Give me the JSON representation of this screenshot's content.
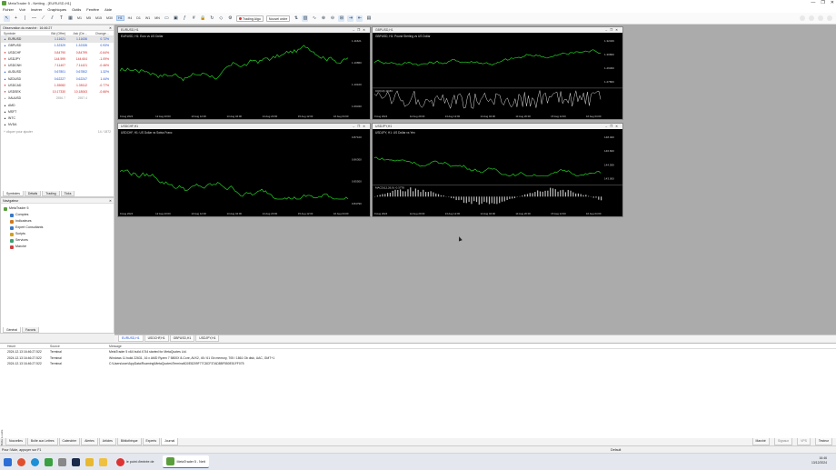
{
  "window": {
    "title": "MetaTrader 5 - Netting - [EURUSD,H1]",
    "min": "—",
    "max": "❐",
    "close": "✕"
  },
  "menu": [
    "Fichier",
    "Voir",
    "Insérer",
    "Graphiques",
    "Outils",
    "Fenêtre",
    "Aide"
  ],
  "toolbar": {
    "timeframes": [
      "M1",
      "M5",
      "M15",
      "M30",
      "H1",
      "H4",
      "D1",
      "W1",
      "MN"
    ],
    "active_timeframe": "H1",
    "algo_label": "Trading Algo",
    "order_label": "Nouvel ordre"
  },
  "market_watch": {
    "title": "Observation du marché : 16:46:27",
    "headers": [
      "Symbole",
      "Bid (Offre)",
      "Ask (De…",
      "Change…"
    ],
    "rows": [
      {
        "symbol": "EURUSD",
        "bid": "1.11621",
        "ask": "1.11636",
        "change": "0.72%",
        "color": "blue"
      },
      {
        "symbol": "GBPUSD",
        "bid": "1.32329",
        "ask": "1.32335",
        "change": "0.93%",
        "color": "blue"
      },
      {
        "symbol": "USDCHF",
        "bid": "0.84790",
        "ask": "0.84799",
        "change": "-0.64%",
        "color": "red"
      },
      {
        "symbol": "USDJPY",
        "bid": "144.599",
        "ask": "144.604",
        "change": "-1.09%",
        "color": "red"
      },
      {
        "symbol": "USDCNH",
        "bid": "7.11407",
        "ask": "7.11421",
        "change": "-0.46%",
        "color": "red"
      },
      {
        "symbol": "AUDUSD",
        "bid": "0.67801",
        "ask": "0.67802",
        "change": "1.32%",
        "color": "blue"
      },
      {
        "symbol": "NZDUSD",
        "bid": "0.62227",
        "ask": "0.62247",
        "change": "1.44%",
        "color": "blue"
      },
      {
        "symbol": "USDCAD",
        "bid": "1.35082",
        "ask": "1.35112",
        "change": "-0.77%",
        "color": "red"
      },
      {
        "symbol": "USDSEK",
        "bid": "10.17330",
        "ask": "10.18063",
        "change": "-0.66%",
        "color": "red"
      },
      {
        "symbol": "XAUUSD",
        "bid": "2556.7",
        "ask": "2557.4",
        "change": "",
        "color": "grey"
      },
      {
        "symbol": "AMD",
        "bid": "",
        "ask": "",
        "change": "",
        "color": "plain"
      },
      {
        "symbol": "MSFT",
        "bid": "",
        "ask": "",
        "change": "",
        "color": "plain"
      },
      {
        "symbol": "INTC",
        "bid": "",
        "ask": "",
        "change": "",
        "color": "plain"
      },
      {
        "symbol": "NVDA",
        "bid": "",
        "ask": "",
        "change": "",
        "color": "plain"
      }
    ],
    "add_symbol": "+ cliquer pour ajouter",
    "count": "14 / 1872",
    "tabs": [
      "Symboles",
      "Détails",
      "Trading",
      "Ticks"
    ]
  },
  "navigator": {
    "title": "Navigateur",
    "items": [
      {
        "label": "MetaTrader 5",
        "indent": 0,
        "color": "#5a9e3c"
      },
      {
        "label": "Comptes",
        "indent": 1,
        "color": "#3a78c8"
      },
      {
        "label": "Indicateurs",
        "indent": 1,
        "color": "#d07a20"
      },
      {
        "label": "Expert Consultants",
        "indent": 1,
        "color": "#3a78c8"
      },
      {
        "label": "Scripts",
        "indent": 1,
        "color": "#d0a020"
      },
      {
        "label": "Services",
        "indent": 1,
        "color": "#3aa070"
      },
      {
        "label": "Marché",
        "indent": 1,
        "color": "#d04040"
      }
    ],
    "tabs": [
      "Général",
      "Favoris"
    ]
  },
  "charts": [
    {
      "title": "EURUSD,H1",
      "desc": "EURUSD, H1: Euro vs US Dollar",
      "line": "#22cc22",
      "sub": null,
      "prices": [
        "1.11621",
        "1.10860",
        "1.10100",
        "1.09340"
      ],
      "dates": [
        "9 Aug 2024",
        "12 Aug 20:00",
        "13 Aug 12:00",
        "14 Aug 04:00",
        "14 Aug 20:00",
        "15 Aug 12:00",
        "16 Aug 04:00"
      ]
    },
    {
      "title": "GBPUSD,H1",
      "desc": "GBPUSD, H1: Pound Sterling vs US Dollar",
      "line": "#22cc22",
      "sub": "CCI(14) 10.83",
      "prices": [
        "1.32329",
        "1.30800",
        "1.29300",
        "1.27800"
      ],
      "dates": [
        "9 Aug 2024",
        "12 Aug 20:00",
        "13 Aug 12:00",
        "14 Aug 04:00",
        "14 Aug 20:00",
        "15 Aug 12:00",
        "16 Aug 04:00"
      ]
    },
    {
      "title": "USDCHF,H1",
      "desc": "USDCHF, H1: US Dollar vs Swiss Franc",
      "line": "#22cc22",
      "sub": null,
      "prices": [
        "0.87100",
        "0.86300",
        "0.85500",
        "0.84790"
      ],
      "dates": [
        "9 Aug 2024",
        "12 Aug 20:00",
        "13 Aug 12:00",
        "14 Aug 04:00",
        "14 Aug 20:00",
        "15 Aug 12:00",
        "16 Aug 04:00"
      ]
    },
    {
      "title": "USDJPY,H1",
      "desc": "USDJPY, H1: US Dollar vs Yen",
      "line": "#22cc22",
      "sub": "MACD(12,26,9) -0.3778",
      "prices": [
        "148.400",
        "146.600",
        "144.599",
        "143.000"
      ],
      "dates": [
        "9 Aug 2024",
        "12 Aug 20:00",
        "13 Aug 12:00",
        "14 Aug 04:00",
        "14 Aug 20:00",
        "15 Aug 12:00",
        "16 Aug 04:00"
      ]
    }
  ],
  "chart_tabs": [
    "EURUSD,H1",
    "USDCHF,H1",
    "GBPUSD,H1",
    "USDJPY,H1"
  ],
  "journal": {
    "headers": [
      "Heure",
      "Source",
      "Message"
    ],
    "rows": [
      {
        "time": "2024.12.13 16:46:27.522",
        "source": "Terminal",
        "message": "MetaTrader 5 x64 build 4744 started for MetaQuotes Ltd."
      },
      {
        "time": "2024.12.13 16:46:27.522",
        "source": "Terminal",
        "message": "Windows 11 build 22631, 16 x AMD Ryzen 7 5800X 8-Core, AVX2, 45 / 61 Gb memory, 705 / 1861 Gb disk, UAC, GMT+1"
      },
      {
        "time": "2024.12.13 16:46:27.522",
        "source": "Terminal",
        "message": "C:\\Users\\user\\AppData\\Roaming\\MetaQuotes\\Terminal\\D0E8209F77C8CF37AD8BF550E51FF075"
      }
    ],
    "side_label": "Boîte à outils"
  },
  "bottom_tabs": [
    "Nouvelles",
    "Boîte aux Lettres",
    "Calendrier",
    "Alertes",
    "Articles",
    "Bibliothèque",
    "Experts",
    "Journal"
  ],
  "bottom_right": [
    "Marché",
    "Signaux",
    "VPS",
    "Testeur"
  ],
  "status": {
    "help": "Pour l'Aide, appuyer sur F1",
    "profile": "Default"
  },
  "taskbar": {
    "browser": "le point d'entrée de",
    "app": "MetaTrader 5 - Nett",
    "time": "16:46",
    "date": "13/12/2024"
  }
}
